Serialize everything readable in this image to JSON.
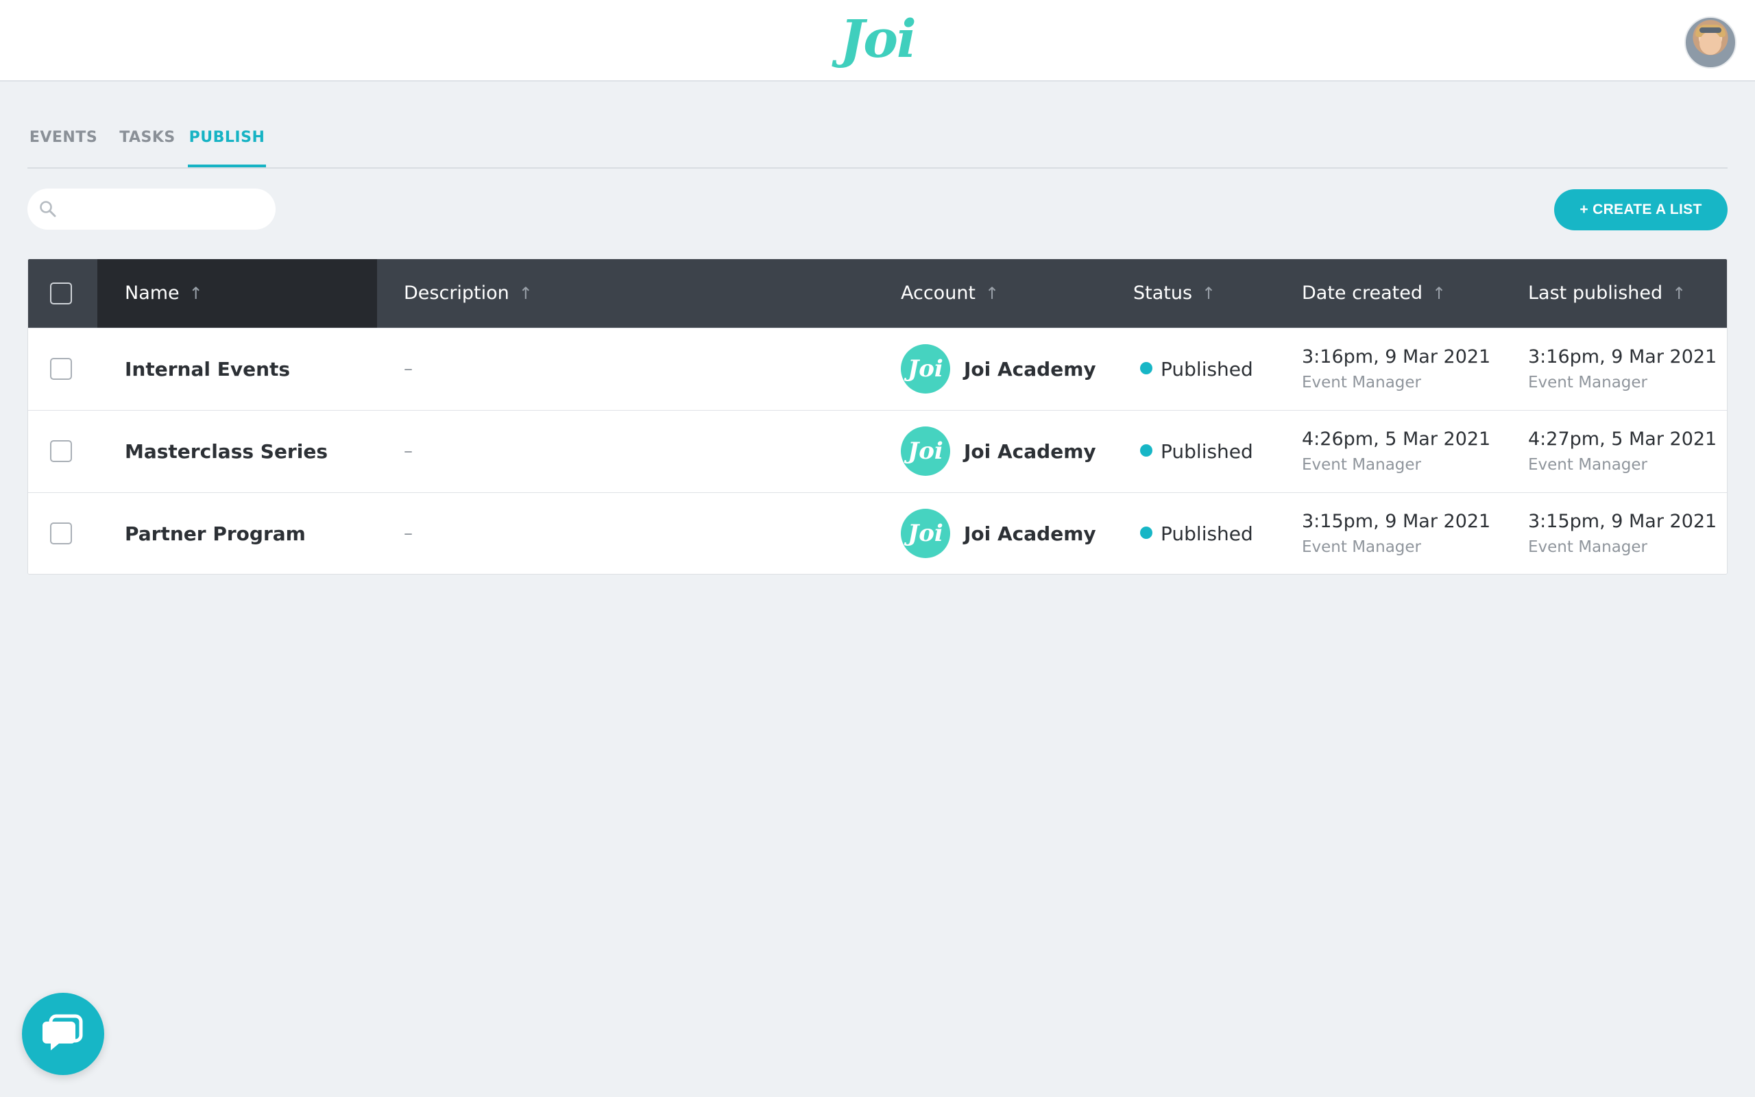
{
  "header": {
    "logo_text": "Joi",
    "avatar_alt": "user-avatar"
  },
  "tabs": [
    {
      "label": "EVENTS",
      "active": false
    },
    {
      "label": "TASKS",
      "active": false
    },
    {
      "label": "PUBLISH",
      "active": true
    }
  ],
  "toolbar": {
    "search_placeholder": "",
    "search_value": "",
    "create_label": "+ CREATE A LIST"
  },
  "table": {
    "columns": [
      {
        "label": "Name",
        "sort_icon": "arrow-up-icon"
      },
      {
        "label": "Description",
        "sort_icon": "arrow-up-icon"
      },
      {
        "label": "Account",
        "sort_icon": "arrow-up-icon"
      },
      {
        "label": "Status",
        "sort_icon": "arrow-up-icon"
      },
      {
        "label": "Date created",
        "sort_icon": "arrow-up-icon"
      },
      {
        "label": "Last published",
        "sort_icon": "arrow-up-icon"
      }
    ],
    "rows": [
      {
        "name": "Internal Events",
        "description": "–",
        "account_logo": "Joi",
        "account": "Joi Academy",
        "status": "Published",
        "date_created": "3:16pm, 9 Mar 2021",
        "created_by": "Event Manager",
        "last_published": "3:16pm, 9 Mar 2021",
        "published_by": "Event Manager"
      },
      {
        "name": "Masterclass Series",
        "description": "–",
        "account_logo": "Joi",
        "account": "Joi Academy",
        "status": "Published",
        "date_created": "4:26pm, 5 Mar 2021",
        "created_by": "Event Manager",
        "last_published": "4:27pm, 5 Mar 2021",
        "published_by": "Event Manager"
      },
      {
        "name": "Partner Program",
        "description": "–",
        "account_logo": "Joi",
        "account": "Joi Academy",
        "status": "Published",
        "date_created": "3:15pm, 9 Mar 2021",
        "created_by": "Event Manager",
        "last_published": "3:15pm, 9 Mar 2021",
        "published_by": "Event Manager"
      }
    ]
  },
  "colors": {
    "accent": "#17b6c6",
    "brand": "#3fcfbd",
    "header_dark": "#3d434b",
    "background": "#eef1f4"
  },
  "chat": {
    "icon": "chat-bubble-icon"
  }
}
